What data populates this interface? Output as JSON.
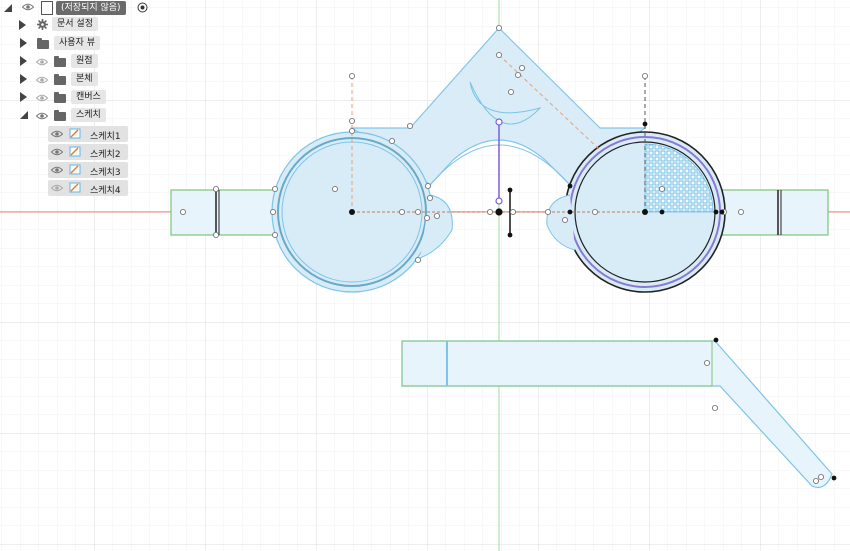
{
  "browser": {
    "root": {
      "label": "(저장되지 않음)"
    },
    "items": [
      {
        "label": "문서 설정",
        "icon": "gear-icon"
      },
      {
        "label": "사용자 뷰",
        "icon": "folder-icon"
      },
      {
        "label": "원점",
        "icon": "folder-icon"
      },
      {
        "label": "본체",
        "icon": "folder-icon"
      },
      {
        "label": "캔버스",
        "icon": "folder-icon"
      },
      {
        "label": "스케치",
        "icon": "folder-icon"
      }
    ],
    "sketches": [
      {
        "label": "스케치1"
      },
      {
        "label": "스케치2"
      },
      {
        "label": "스케치3"
      },
      {
        "label": "스케치4"
      }
    ]
  },
  "colors": {
    "grid": "#e4e4e4",
    "x_axis": "#f08a8a",
    "y_axis": "#9fdc9f",
    "profile_fill": "#d8ecf7",
    "profile_stroke": "#7cc4e8",
    "construction": "#e6a27c",
    "selected": "#7a5fd6",
    "body_green": "#7cc47a"
  }
}
